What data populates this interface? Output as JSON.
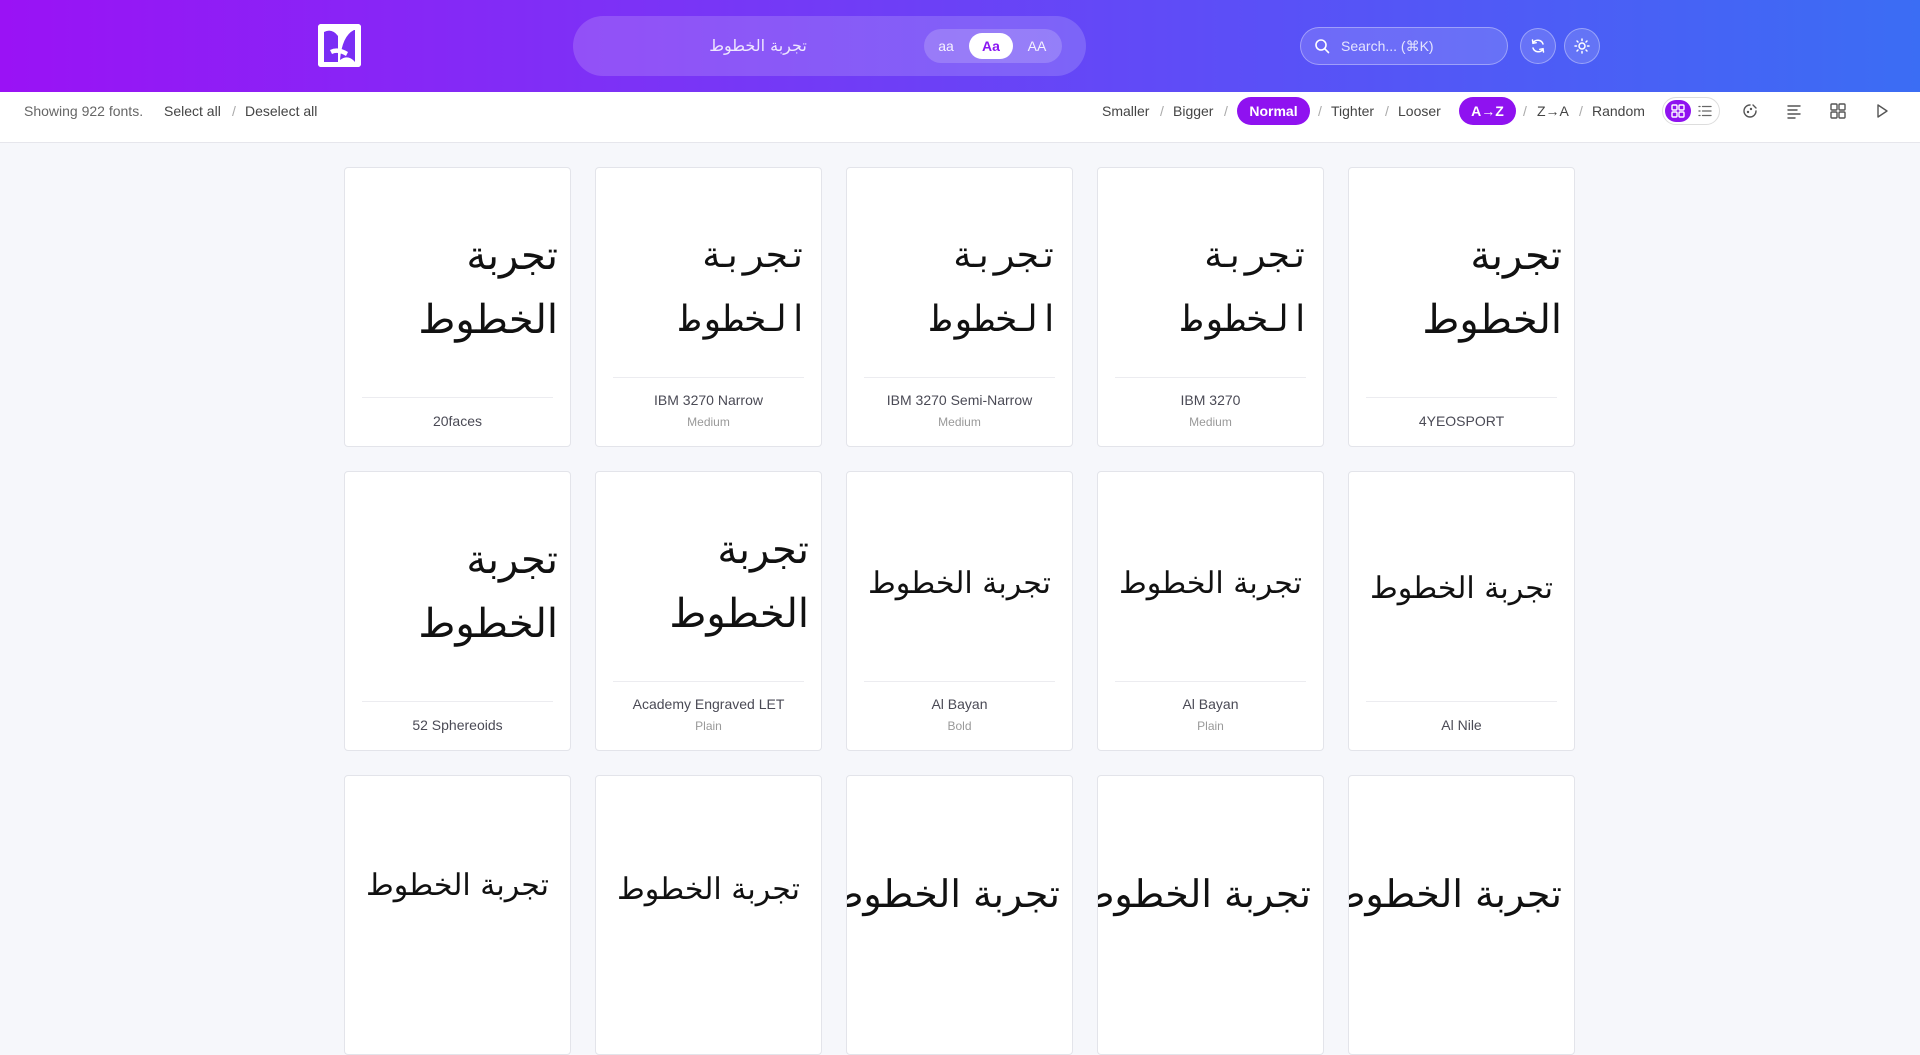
{
  "header": {
    "preview_text": "تجربة الخطوط",
    "case_options": [
      "aa",
      "Aa",
      "AA"
    ],
    "case_selected": "Aa",
    "search_placeholder": "Search... (⌘K)"
  },
  "toolbar": {
    "count_text": "Showing 922 fonts.",
    "select_all": "Select all",
    "deselect_all": "Deselect all",
    "size_options": [
      "Smaller",
      "Bigger",
      "Normal"
    ],
    "size_selected": "Normal",
    "spacing_options": [
      "Tighter",
      "Looser"
    ],
    "sort_options": [
      "A→Z",
      "Z→A",
      "Random"
    ],
    "sort_selected": "A→Z",
    "separator": "/",
    "view_selected": "grid"
  },
  "colors": {
    "accent": "#8f12f0",
    "header_start": "#9a12f5",
    "header_end": "#3b6df4"
  },
  "sample_text": "تجربة الخطوط",
  "fonts": [
    {
      "name": "20faces",
      "style": ""
    },
    {
      "name": "IBM 3270 Narrow",
      "style": "Medium"
    },
    {
      "name": "IBM 3270 Semi-Narrow",
      "style": "Medium"
    },
    {
      "name": "IBM 3270",
      "style": "Medium"
    },
    {
      "name": "4YEOSPORT",
      "style": ""
    },
    {
      "name": "52 Sphereoids",
      "style": ""
    },
    {
      "name": "Academy Engraved LET",
      "style": "Plain"
    },
    {
      "name": "Al Bayan",
      "style": "Bold"
    },
    {
      "name": "Al Bayan",
      "style": "Plain"
    },
    {
      "name": "Al Nile",
      "style": ""
    },
    {
      "name": "",
      "style": ""
    },
    {
      "name": "",
      "style": ""
    },
    {
      "name": "",
      "style": ""
    },
    {
      "name": "",
      "style": ""
    },
    {
      "name": "",
      "style": ""
    }
  ]
}
